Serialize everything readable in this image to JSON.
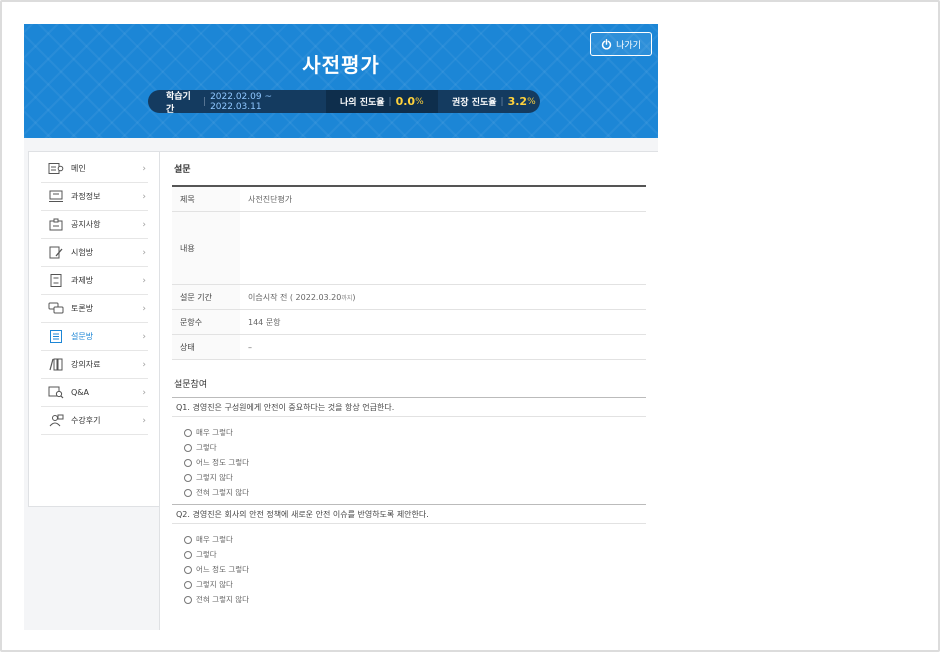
{
  "header": {
    "title": "사전평가",
    "exit_label": "나가기",
    "period_label": "학습기간",
    "period_value": "2022.02.09 ~ 2022.03.11",
    "my_progress_label": "나의 진도율",
    "my_progress_value": "0.0",
    "my_progress_unit": "%",
    "recommended_label": "권장 진도율",
    "recommended_value": "3.2",
    "recommended_unit": "%",
    "accent_color": "#1c86d6",
    "highlight_color": "#ffd23c"
  },
  "sidebar": {
    "items": [
      {
        "label": "메인",
        "icon": "home-icon"
      },
      {
        "label": "과정정보",
        "icon": "monitor-icon"
      },
      {
        "label": "공지사항",
        "icon": "notice-icon"
      },
      {
        "label": "시험방",
        "icon": "exam-icon"
      },
      {
        "label": "과제방",
        "icon": "assignment-icon"
      },
      {
        "label": "토론방",
        "icon": "discussion-icon"
      },
      {
        "label": "설문방",
        "icon": "survey-icon"
      },
      {
        "label": "강의자료",
        "icon": "books-icon"
      },
      {
        "label": "Q&A",
        "icon": "qna-icon"
      },
      {
        "label": "수강후기",
        "icon": "review-icon"
      }
    ],
    "active_index": 6
  },
  "survey": {
    "section_title": "설문",
    "rows": [
      {
        "key": "제목",
        "value": "사전진단평가"
      },
      {
        "key": "내용",
        "value": ""
      },
      {
        "key": "설문 기간",
        "value": "이습시작 전 ( 2022.03.20 ",
        "value_small": "까지",
        "value_end": " )"
      },
      {
        "key": "문항수",
        "value": "144 문항"
      },
      {
        "key": "상태",
        "value": "–"
      }
    ]
  },
  "participation": {
    "section_title": "설문참여",
    "questions": [
      {
        "text": "Q1. 경영진은 구성원에게 안전이 중요하다는 것을 항상 언급한다.",
        "options": [
          "매우 그렇다",
          "그렇다",
          "어느 정도 그렇다",
          "그렇지 않다",
          "전혀 그렇지 않다"
        ]
      },
      {
        "text": "Q2. 경영진은 회사의 안전 정책에 새로운 안전 이슈를 반영하도록 제안한다.",
        "options": [
          "매우 그렇다",
          "그렇다",
          "어느 정도 그렇다",
          "그렇지 않다",
          "전혀 그렇지 않다"
        ]
      }
    ]
  }
}
